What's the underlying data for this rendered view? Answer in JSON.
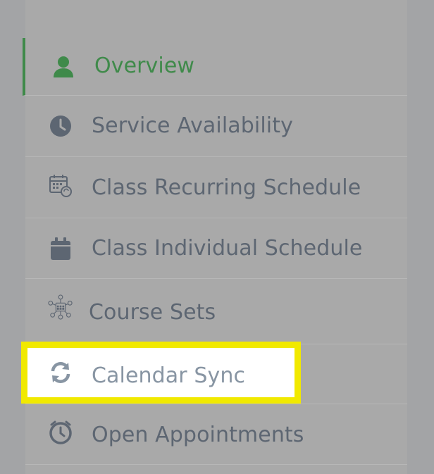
{
  "menu": {
    "items": [
      {
        "label": "Overview",
        "icon": "user-icon",
        "active": true
      },
      {
        "label": "Service Availability",
        "icon": "clock-icon"
      },
      {
        "label": "Class Recurring Schedule",
        "icon": "calendar-recurring-icon"
      },
      {
        "label": "Class Individual Schedule",
        "icon": "calendar-icon"
      },
      {
        "label": "Course Sets",
        "icon": "course-network-icon"
      },
      {
        "label": "Calendar Sync",
        "icon": "sync-icon",
        "highlighted": true
      },
      {
        "label": "Open Appointments",
        "icon": "appointment-clock-icon"
      }
    ]
  },
  "colors": {
    "active_accent": "#3f8a4a",
    "text_muted": "#5d6672",
    "highlight_border": "#f1e900",
    "highlight_text": "#8895a3"
  }
}
